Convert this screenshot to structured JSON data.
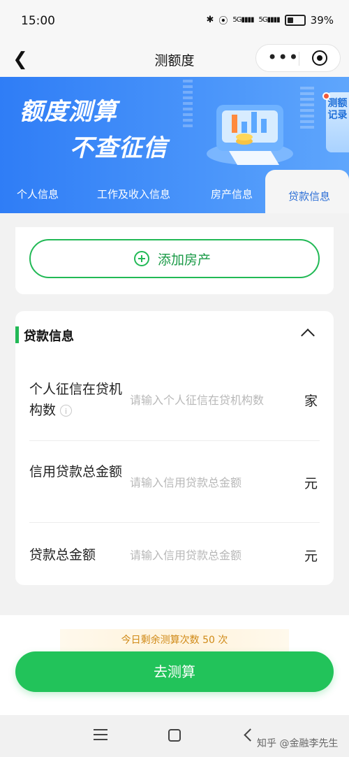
{
  "status_bar": {
    "time": "15:00",
    "network_1": "5G",
    "network_2": "5G",
    "battery": "39%"
  },
  "nav": {
    "title": "测额度"
  },
  "banner": {
    "line1": "额度测算",
    "line2": "不查征信",
    "record_label": "测额记录"
  },
  "tabs": [
    {
      "label": "个人信息"
    },
    {
      "label": "工作及收入信息"
    },
    {
      "label": "房产信息"
    },
    {
      "label": "贷款信息"
    }
  ],
  "property": {
    "add_label": "添加房产"
  },
  "loan_section": {
    "title": "贷款信息",
    "rows": [
      {
        "label": "个人征信在贷机构数",
        "placeholder": "请输入个人征信在贷机构数",
        "unit": "家"
      },
      {
        "label": "信用贷款总金额",
        "placeholder": "请输入信用贷款总金额",
        "unit": "元"
      },
      {
        "label": "贷款总金额",
        "placeholder": "请输入信用贷款总金额",
        "unit": "元"
      }
    ]
  },
  "bottom": {
    "quota_text": "今日剩余测算次数 50 次",
    "go_label": "去测算"
  },
  "watermark": "知乎 @金融李先生",
  "colors": {
    "primary_blue": "#2f7df6",
    "primary_green": "#22c35a",
    "quota_text": "#d08a17"
  }
}
